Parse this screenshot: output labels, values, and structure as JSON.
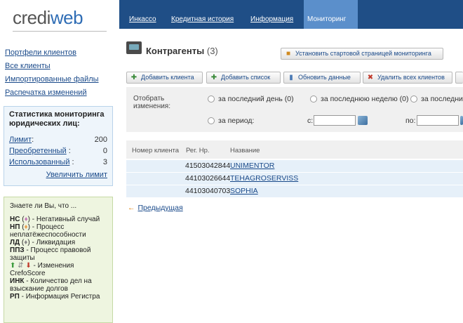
{
  "logo": {
    "part1": "credi",
    "part2": "web"
  },
  "top_nav": [
    {
      "label": "Инкассо",
      "active": false
    },
    {
      "label": "Кредитная история",
      "active": false
    },
    {
      "label": "Информация",
      "active": false
    },
    {
      "label": "Мониторинг",
      "active": true
    }
  ],
  "left_nav": [
    "Портфели клиентов",
    "Все клиенты",
    "Импортированные файлы",
    "Распечатка изменений"
  ],
  "stats": {
    "title": "Статистика мониторинга юридических лиц:",
    "rows": [
      {
        "label": "Лимит",
        "sep": ":",
        "value": "200"
      },
      {
        "label": "Преобретенный",
        "sep": " :",
        "value": "0"
      },
      {
        "label": "Использованный",
        "sep": " :",
        "value": "3"
      }
    ],
    "more_link": "Увеличить лимит"
  },
  "tips": {
    "intro": "Знаете ли Вы, что ...",
    "items": [
      {
        "code": "НС",
        "open": " (",
        "close": ")",
        "text": " - Негативный случай",
        "icon": "gem-pink"
      },
      {
        "code": "НП",
        "open": " (",
        "close": ")",
        "text": " - Процесс неплатёжеспособности",
        "icon": "gem-orange"
      },
      {
        "code": "ЛД",
        "open": " (",
        "close": ")",
        "text": " - Ликвидация",
        "icon": "gem-gray"
      },
      {
        "code": "ППЗ",
        "text": " - Процесс правовой защиты"
      },
      {
        "code": "",
        "text": " - Изменения CrefoScore",
        "icon": "arrows"
      },
      {
        "code": "ИНК",
        "text": " - Количество дел на взыскание долгов"
      },
      {
        "code": "РП",
        "text": " - Информация Регистра"
      }
    ]
  },
  "header": {
    "title": "Контрагенты",
    "count": "(3)"
  },
  "set_start_button": "Установить стартовой страницей мониторинга",
  "toolbar": {
    "add_client": "Добавить клиента",
    "add_list": "Добавить список",
    "refresh": "Обновить данные",
    "delete_all": "Удалить всех клиентов"
  },
  "filter": {
    "label": "Отобрать изменения:",
    "options": [
      "за последний день (0)",
      "за последнюю неделю (0)",
      "за последний",
      "за период:"
    ],
    "from_label": "с:",
    "to_label": "по:"
  },
  "table": {
    "columns": [
      "Номер клиента",
      "Рег. Нр.",
      "Название"
    ],
    "rows": [
      {
        "client_no": "",
        "reg": "41503042844",
        "name": "UNIMENTOR"
      },
      {
        "client_no": "",
        "reg": "44103026644",
        "name": "TEHAGROSERVISS"
      },
      {
        "client_no": "",
        "reg": "44103040703",
        "name": "SOPHIA"
      }
    ]
  },
  "prev_link": "Предыдущая",
  "colors": {
    "topbar": "#1f4e86",
    "active_tab": "#5b8fcb",
    "link": "#1a4a8a",
    "stats_bg": "#eef5fb",
    "tips_bg": "#eef5e0",
    "row_bg": "#e6f0f9"
  }
}
